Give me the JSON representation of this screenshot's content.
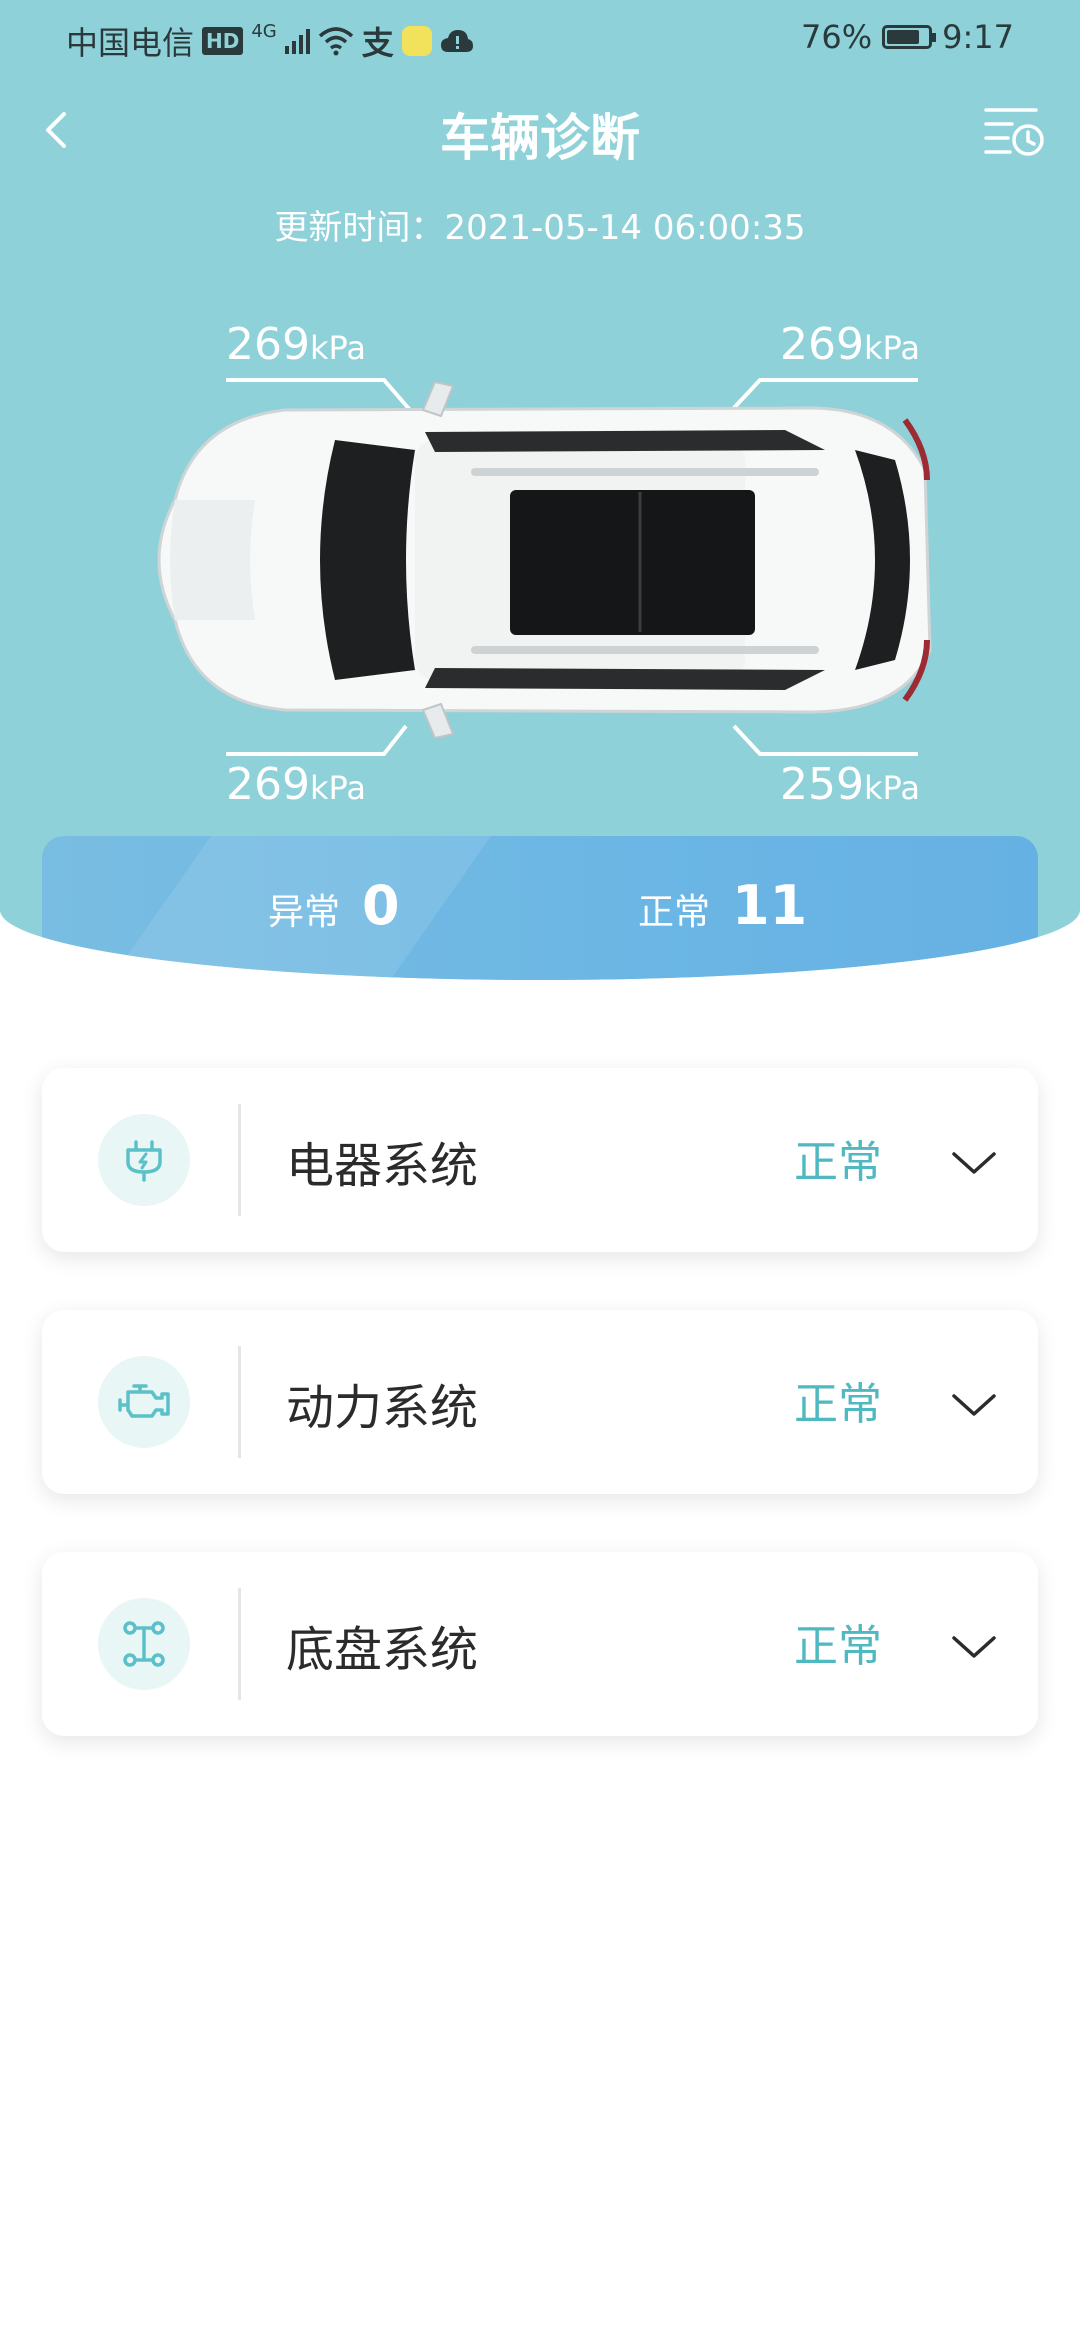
{
  "status_bar": {
    "carrier": "中国电信",
    "hd": "HD",
    "network": "4G",
    "alipay": "支",
    "battery_percent": "76%",
    "time": "9:17"
  },
  "header": {
    "title": "车辆诊断",
    "update_time": "更新时间：2021-05-14 06:00:35"
  },
  "tires": {
    "front_left": {
      "value": "269",
      "unit": "kPa"
    },
    "front_right": {
      "value": "269",
      "unit": "kPa"
    },
    "rear_left": {
      "value": "269",
      "unit": "kPa"
    },
    "rear_right": {
      "value": "259",
      "unit": "kPa"
    }
  },
  "summary": {
    "abnormal_label": "异常",
    "abnormal_count": "0",
    "normal_label": "正常",
    "normal_count": "11"
  },
  "systems": [
    {
      "name": "电器系统",
      "status": "正常",
      "icon": "plug-icon"
    },
    {
      "name": "动力系统",
      "status": "正常",
      "icon": "engine-icon"
    },
    {
      "name": "底盘系统",
      "status": "正常",
      "icon": "chassis-icon"
    }
  ],
  "colors": {
    "hero_bg": "#8ed1d9",
    "accent": "#4fb8c0",
    "summary_bar": "#6bb6e4"
  }
}
